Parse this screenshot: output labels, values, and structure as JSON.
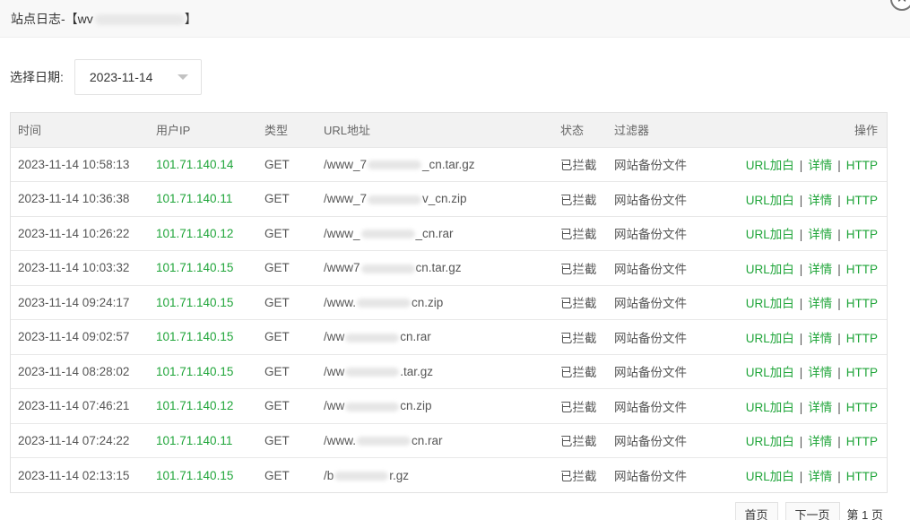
{
  "dialog": {
    "title_prefix": "站点日志-【wv",
    "title_suffix": "】",
    "close_symbol": "✕"
  },
  "filter": {
    "label": "选择日期:",
    "date_value": "2023-11-14"
  },
  "table": {
    "headers": [
      "时间",
      "用户IP",
      "类型",
      "URL地址",
      "状态",
      "过滤器",
      "操作"
    ],
    "actions": {
      "whitelist": "URL加白",
      "detail": "详情",
      "http": "HTTP",
      "separator": "|"
    },
    "rows": [
      {
        "time": "2023-11-14 10:58:13",
        "ip": "101.71.140.14",
        "type": "GET",
        "url_start": "/www_7",
        "url_end": "_cn.tar.gz",
        "status": "已拦截",
        "filter": "网站备份文件"
      },
      {
        "time": "2023-11-14 10:36:38",
        "ip": "101.71.140.11",
        "type": "GET",
        "url_start": "/www_7",
        "url_end": "v_cn.zip",
        "status": "已拦截",
        "filter": "网站备份文件"
      },
      {
        "time": "2023-11-14 10:26:22",
        "ip": "101.71.140.12",
        "type": "GET",
        "url_start": "/www_",
        "url_end": "_cn.rar",
        "status": "已拦截",
        "filter": "网站备份文件"
      },
      {
        "time": "2023-11-14 10:03:32",
        "ip": "101.71.140.15",
        "type": "GET",
        "url_start": "/www7",
        "url_end": "cn.tar.gz",
        "status": "已拦截",
        "filter": "网站备份文件"
      },
      {
        "time": "2023-11-14 09:24:17",
        "ip": "101.71.140.15",
        "type": "GET",
        "url_start": "/www.",
        "url_end": "cn.zip",
        "status": "已拦截",
        "filter": "网站备份文件"
      },
      {
        "time": "2023-11-14 09:02:57",
        "ip": "101.71.140.15",
        "type": "GET",
        "url_start": "/ww",
        "url_end": "cn.rar",
        "status": "已拦截",
        "filter": "网站备份文件"
      },
      {
        "time": "2023-11-14 08:28:02",
        "ip": "101.71.140.15",
        "type": "GET",
        "url_start": "/ww",
        "url_end": ".tar.gz",
        "status": "已拦截",
        "filter": "网站备份文件"
      },
      {
        "time": "2023-11-14 07:46:21",
        "ip": "101.71.140.12",
        "type": "GET",
        "url_start": "/ww",
        "url_end": "cn.zip",
        "status": "已拦截",
        "filter": "网站备份文件"
      },
      {
        "time": "2023-11-14 07:24:22",
        "ip": "101.71.140.11",
        "type": "GET",
        "url_start": "/www.",
        "url_end": "cn.rar",
        "status": "已拦截",
        "filter": "网站备份文件"
      },
      {
        "time": "2023-11-14 02:13:15",
        "ip": "101.71.140.15",
        "type": "GET",
        "url_start": "/b",
        "url_end": "r.gz",
        "status": "已拦截",
        "filter": "网站备份文件"
      }
    ]
  },
  "pager": {
    "first": "首页",
    "next": "下一页",
    "current": "第 1 页"
  },
  "colors": {
    "accent_green": "#20a53a"
  }
}
